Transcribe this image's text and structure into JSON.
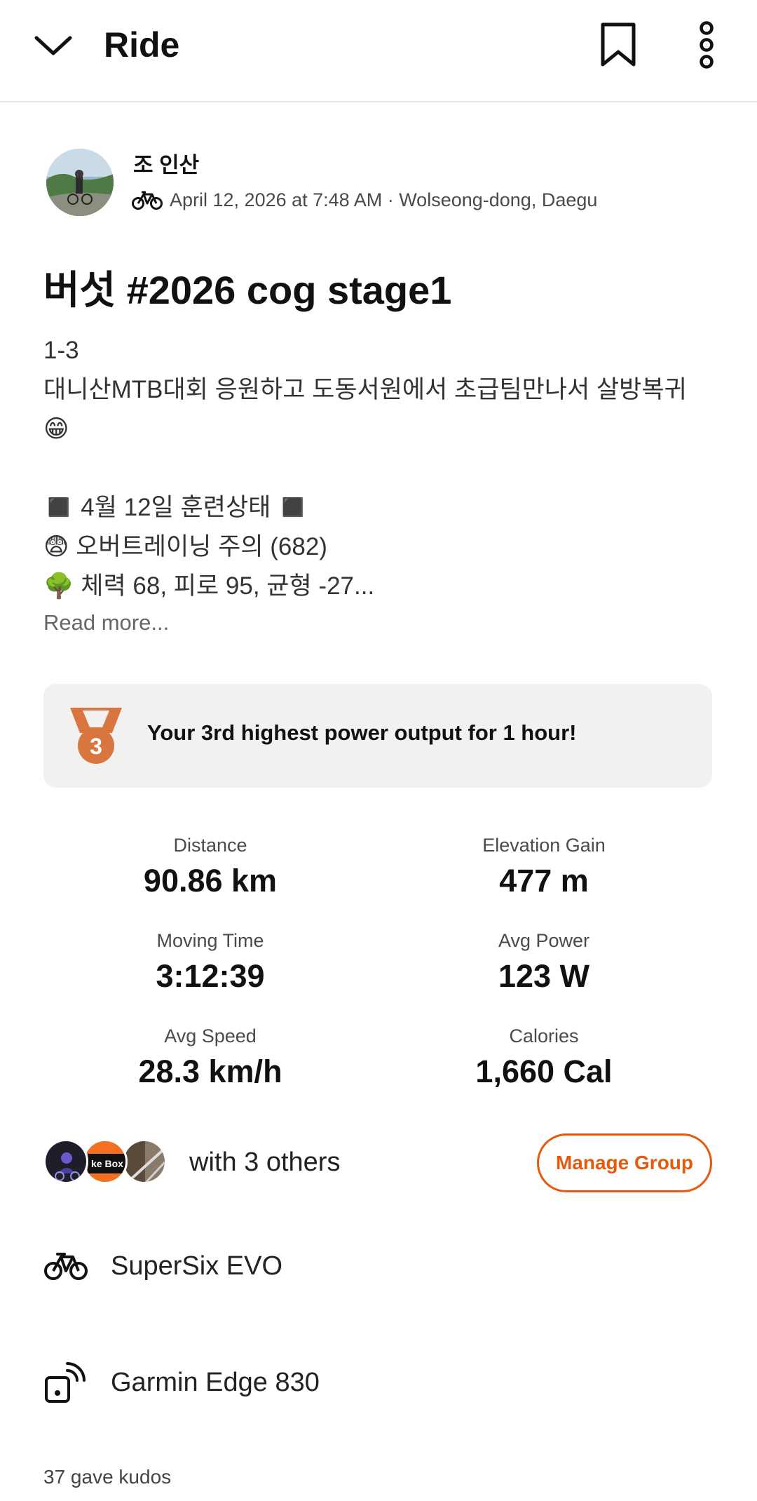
{
  "header": {
    "title": "Ride",
    "back_icon": "chevron-down-icon",
    "bookmark_icon": "bookmark-icon",
    "more_icon": "more-vertical-icon"
  },
  "athlete": {
    "name": "조 인산",
    "activity_icon": "bicycle-icon",
    "meta": "April 12, 2026 at 7:48 AM · Wolseong-dong, Daegu"
  },
  "activity": {
    "title": "버섯 #2026 cog stage1",
    "description_lines": [
      "1-3",
      "대니산MTB대회 응원하고 도동서원에서 초급팀만나서 살방복귀",
      "😁",
      "",
      "◼️ 4월 12일 훈련상태 ◼️",
      "😨 오버트레이닝 주의 (682)",
      "🌳 체력 68, 피로 95, 균형 -27..."
    ],
    "read_more": "Read more..."
  },
  "achievement": {
    "icon": "bronze-medal-icon",
    "medal_rank": "3",
    "text": "Your 3rd highest power output for 1 hour!"
  },
  "stats": [
    {
      "label": "Distance",
      "value": "90.86 km"
    },
    {
      "label": "Elevation Gain",
      "value": "477 m"
    },
    {
      "label": "Moving Time",
      "value": "3:12:39"
    },
    {
      "label": "Avg Power",
      "value": "123 W"
    },
    {
      "label": "Avg Speed",
      "value": "28.3 km/h"
    },
    {
      "label": "Calories",
      "value": "1,660 Cal"
    }
  ],
  "group": {
    "avatar_badge_text": "ke Box",
    "text": "with 3 others",
    "button": "Manage Group"
  },
  "gear": {
    "bike_icon": "bicycle-icon",
    "bike": "SuperSix EVO",
    "device_icon": "device-signal-icon",
    "device": "Garmin Edge 830"
  },
  "kudos": "37 gave kudos",
  "colors": {
    "accent": "#e8590c",
    "medal": "#d9763f",
    "card_bg": "#f1f1ef"
  }
}
